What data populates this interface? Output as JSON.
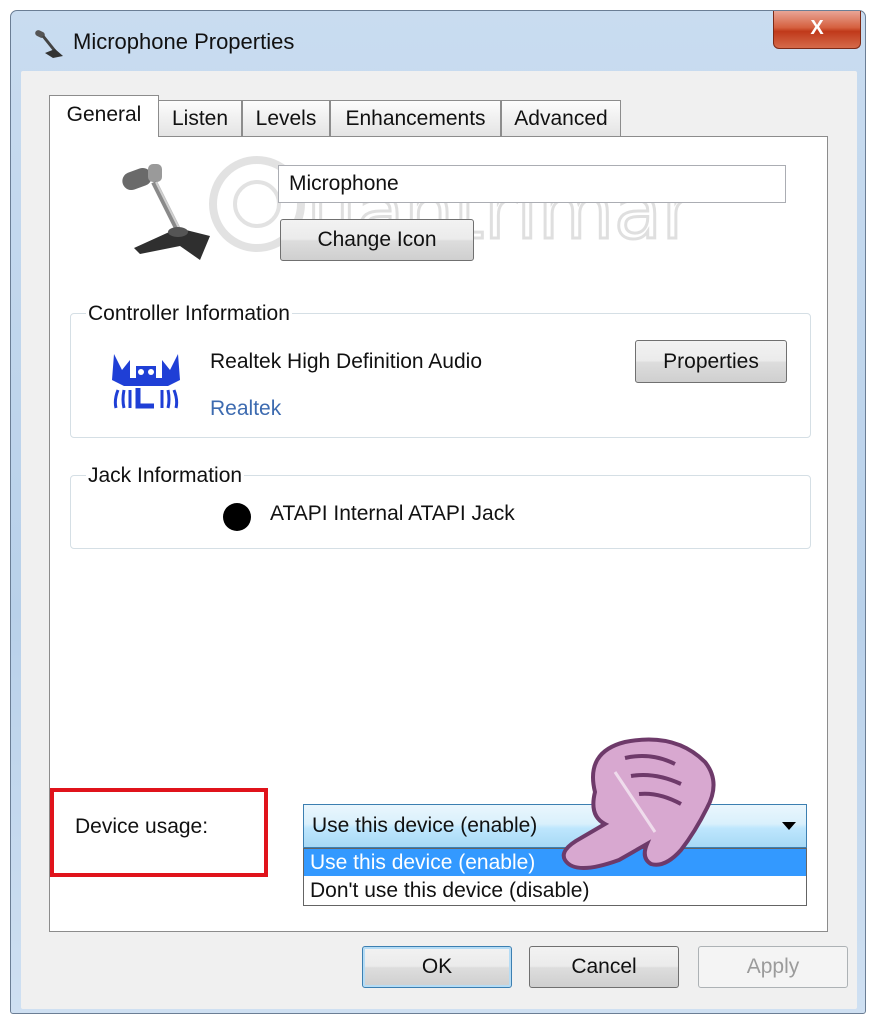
{
  "window": {
    "title": "Microphone Properties",
    "close_label": "X"
  },
  "tabs": [
    {
      "label": "General",
      "active": true
    },
    {
      "label": "Listen",
      "active": false
    },
    {
      "label": "Levels",
      "active": false
    },
    {
      "label": "Enhancements",
      "active": false
    },
    {
      "label": "Advanced",
      "active": false
    }
  ],
  "general": {
    "device_name": "Microphone",
    "change_icon_label": "Change Icon",
    "controller_group_label": "Controller Information",
    "controller_name": "Realtek High Definition Audio",
    "controller_vendor": "Realtek",
    "properties_label": "Properties",
    "jack_group_label": "Jack Information",
    "jack_name": "ATAPI Internal ATAPI Jack",
    "device_usage_label": "Device usage:",
    "device_usage_selected": "Use this device (enable)",
    "device_usage_options": [
      "Use this device (enable)",
      "Don't use this device (disable)"
    ]
  },
  "footer": {
    "ok_label": "OK",
    "cancel_label": "Cancel",
    "apply_label": "Apply"
  },
  "watermark_text": "Quantrimang",
  "colors": {
    "highlight": "#3399ff",
    "annotation_red": "#e0131b",
    "vendor_link": "#3d6bb0"
  },
  "icons": [
    "microphone-icon",
    "realtek-logo-icon",
    "hand-pointer-icon",
    "close-icon",
    "dropdown-arrow-icon"
  ]
}
